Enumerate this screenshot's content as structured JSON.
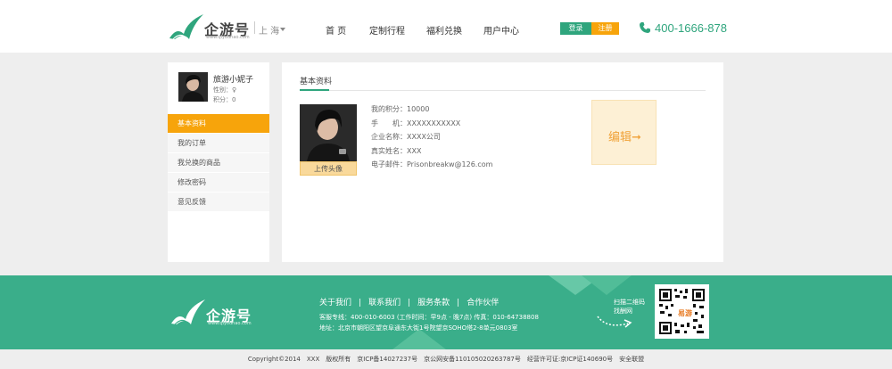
{
  "header": {
    "logo_text": "企游号",
    "logo_sub": "www.qiyouhao.com",
    "city": "上 海",
    "nav": [
      "首 页",
      "定制行程",
      "福利兑换",
      "用户中心"
    ],
    "login_label": "登录",
    "register_label": "注册",
    "phone": "400-1666-878"
  },
  "sidebar": {
    "user_name": "旅游小妮子",
    "gender_label": "性别：♀",
    "points_label": "积分：0",
    "menu": [
      {
        "label": "基本资料",
        "active": true
      },
      {
        "label": "我的订单",
        "active": false
      },
      {
        "label": "我兑换的商品",
        "active": false
      },
      {
        "label": "修改密码",
        "active": false
      },
      {
        "label": "意见反馈",
        "active": false
      }
    ]
  },
  "main": {
    "tab": "基本资料",
    "upload_label": "上传头像",
    "info": [
      "我的积分：10000",
      "手　　机：XXXXXXXXXXX",
      "企业名称：XXXX公司",
      "真实姓名：XXX",
      "电子邮件：Prisonbreakw@126.com"
    ],
    "edit_label": "编辑➞"
  },
  "footer": {
    "logo_text": "企游号",
    "logo_sub": "www.qiyouhao.com",
    "links": [
      "关于我们",
      "联系我们",
      "服务条款",
      "合作伙伴"
    ],
    "link_sep": "|",
    "line1": "客服专线：400-010-6003 (工作时间：早9点 - 晚7点) 传真：010-64738808",
    "line2": "地址：北京市朝阳区望京阜通东大街1号院望京SOHO塔2-8单元0803室",
    "qr_label_1": "扫描二维码",
    "qr_label_2": "找酬网",
    "qr_center": "易游"
  },
  "copyright": "Copyright©2014　XXX　版权所有　京ICP备14027237号　京公网安备110105020263787号　经营许可证:京ICP证140690号　安全联盟",
  "colors": {
    "brand_green": "#2fa57d",
    "footer_green": "#3aae8a",
    "accent_orange": "#f7a40b"
  }
}
